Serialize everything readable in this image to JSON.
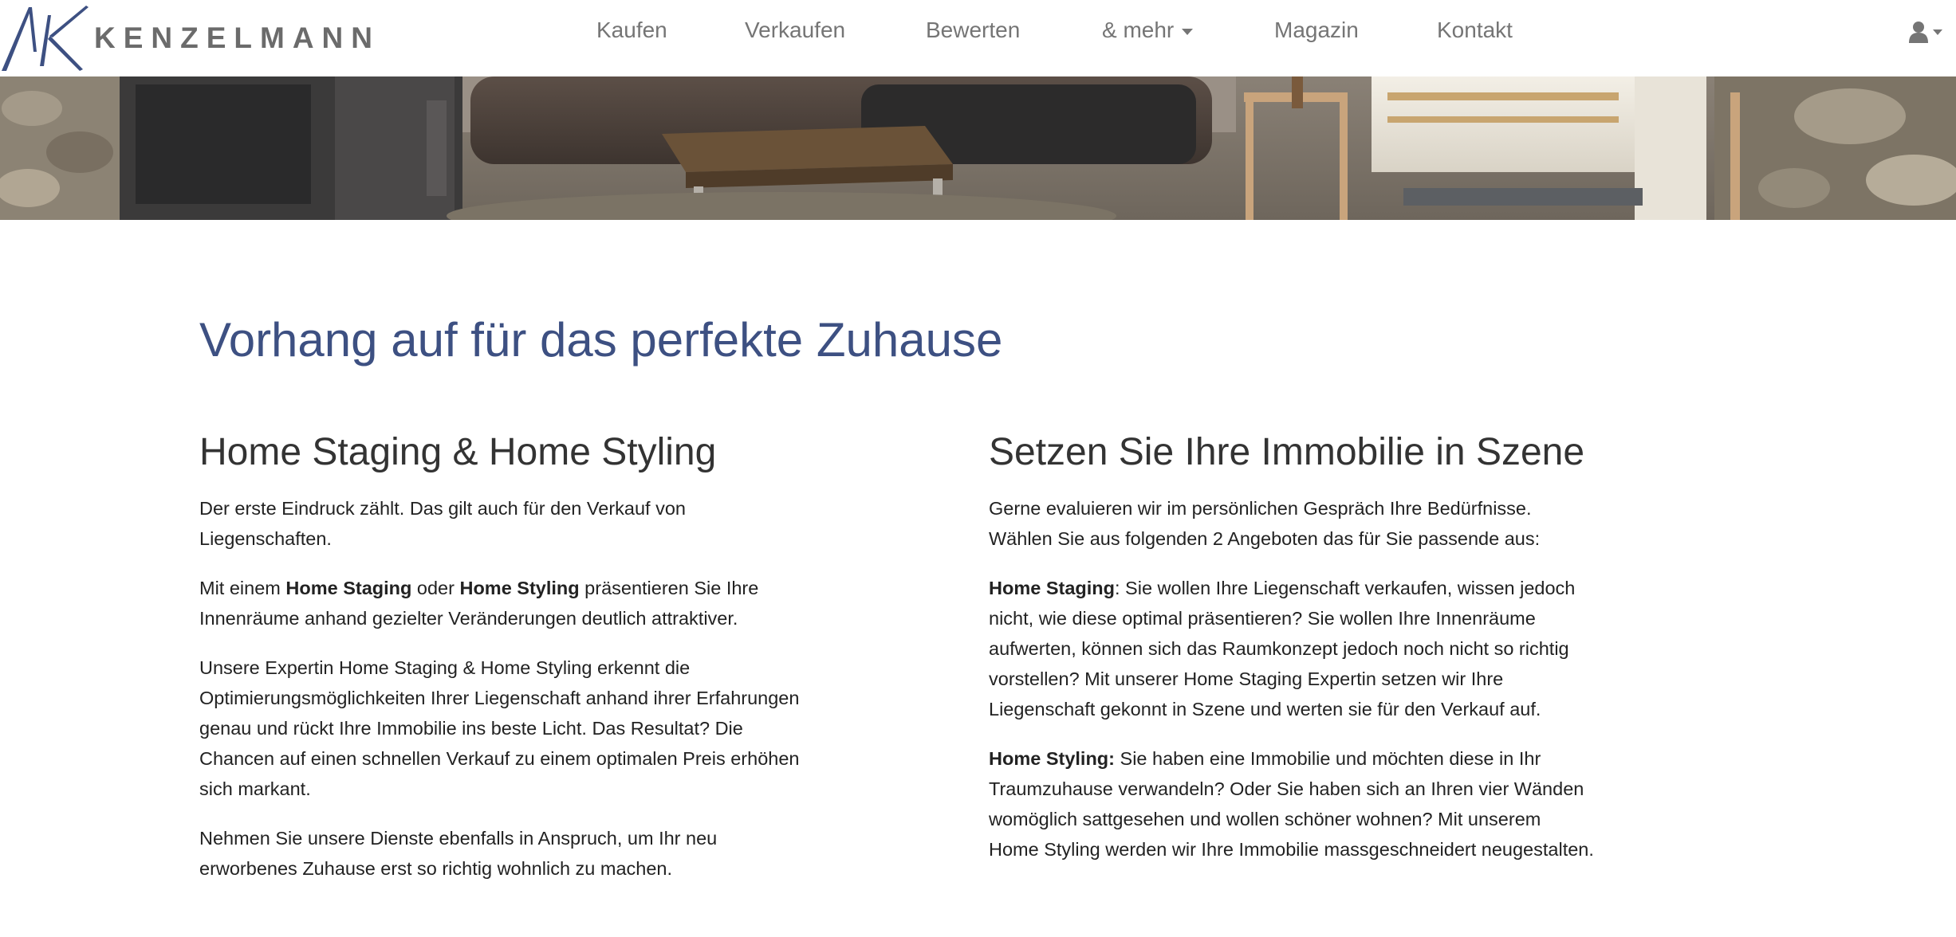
{
  "brand": {
    "logo_text": "KENZELMANN"
  },
  "nav": {
    "items": [
      {
        "label": "Kaufen"
      },
      {
        "label": "Verkaufen"
      },
      {
        "label": "Bewerten"
      },
      {
        "label": "& mehr"
      },
      {
        "label": "Magazin"
      },
      {
        "label": "Kontakt"
      }
    ]
  },
  "hero": {
    "image": "living-room-photo"
  },
  "colors": {
    "title": "#3d5082",
    "nav_text": "#757575",
    "logo_text": "#6b6b6b",
    "body_text": "#222222"
  },
  "main": {
    "title": "Vorhang auf für das perfekte Zuhause",
    "left": {
      "heading": "Home Staging & Home Styling",
      "p1": "Der erste Eindruck zählt. Das gilt auch für den Verkauf von Liegenschaften.",
      "p2_a": "Mit einem ",
      "p2_b": "Home Staging",
      "p2_c": " oder ",
      "p2_d": "Home Styling",
      "p2_e": " präsentieren Sie Ihre Innenräume anhand gezielter Veränderungen deutlich attraktiver.",
      "p3": "Unsere Expertin Home Staging & Home Styling erkennt die Optimierungsmöglichkeiten Ihrer Liegenschaft anhand ihrer Erfahrungen genau und rückt Ihre Immobilie ins beste Licht. Das Resultat? Die Chancen auf einen schnellen Verkauf zu einem optimalen Preis erhöhen sich markant.",
      "p4": "Nehmen Sie unsere Dienste ebenfalls in Anspruch, um Ihr neu erworbenes Zuhause erst so richtig wohnlich zu machen."
    },
    "right": {
      "heading": "Setzen Sie Ihre Immobilie in Szene",
      "p1": "Gerne evaluieren wir im persönlichen Gespräch Ihre Bedürfnisse. Wählen Sie aus folgenden 2 Angeboten das für Sie passende aus:",
      "p2_label": "Home Staging",
      "p2_text": ": Sie wollen Ihre Liegenschaft verkaufen, wissen jedoch nicht, wie diese optimal präsentieren? Sie wollen Ihre Innenräume aufwerten, können sich das Raumkonzept jedoch noch nicht so richtig vorstellen? Mit unserer Home Staging Expertin setzen wir Ihre Liegenschaft gekonnt in Szene und werten sie für den Verkauf auf.",
      "p3_label": "Home Styling:",
      "p3_text": " Sie haben eine Immobilie und möchten diese in Ihr Traumzuhause verwandeln? Oder Sie haben sich an Ihren vier Wänden womöglich sattgesehen und wollen schöner wohnen? Mit unserem Home Styling werden wir Ihre Immobilie massgeschneidert neugestalten."
    }
  }
}
